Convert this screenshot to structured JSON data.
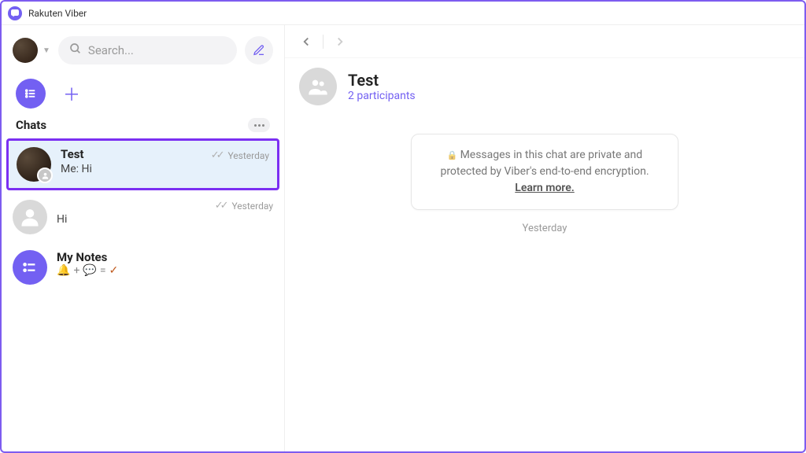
{
  "app": {
    "title": "Rakuten Viber"
  },
  "sidebar": {
    "search_placeholder": "Search...",
    "section_title": "Chats",
    "chats": [
      {
        "name": "Test",
        "preview": "Me: Hi",
        "time": "Yesterday",
        "selected": true,
        "avatar": "photo-group",
        "ticks": true
      },
      {
        "name": "   ",
        "preview": "Hi",
        "time": "Yesterday",
        "selected": false,
        "avatar": "placeholder",
        "ticks": true,
        "blurred": true
      },
      {
        "name": "My Notes",
        "preview": "",
        "time": "",
        "selected": false,
        "avatar": "notes"
      }
    ]
  },
  "main": {
    "header": {
      "name": "Test",
      "subtitle": "2 participants"
    },
    "encryption_notice": {
      "text_a": "Messages in this chat are private and protected by Viber's end-to-end encryption. ",
      "learn": "Learn more."
    },
    "date_separator": "Yesterday"
  }
}
